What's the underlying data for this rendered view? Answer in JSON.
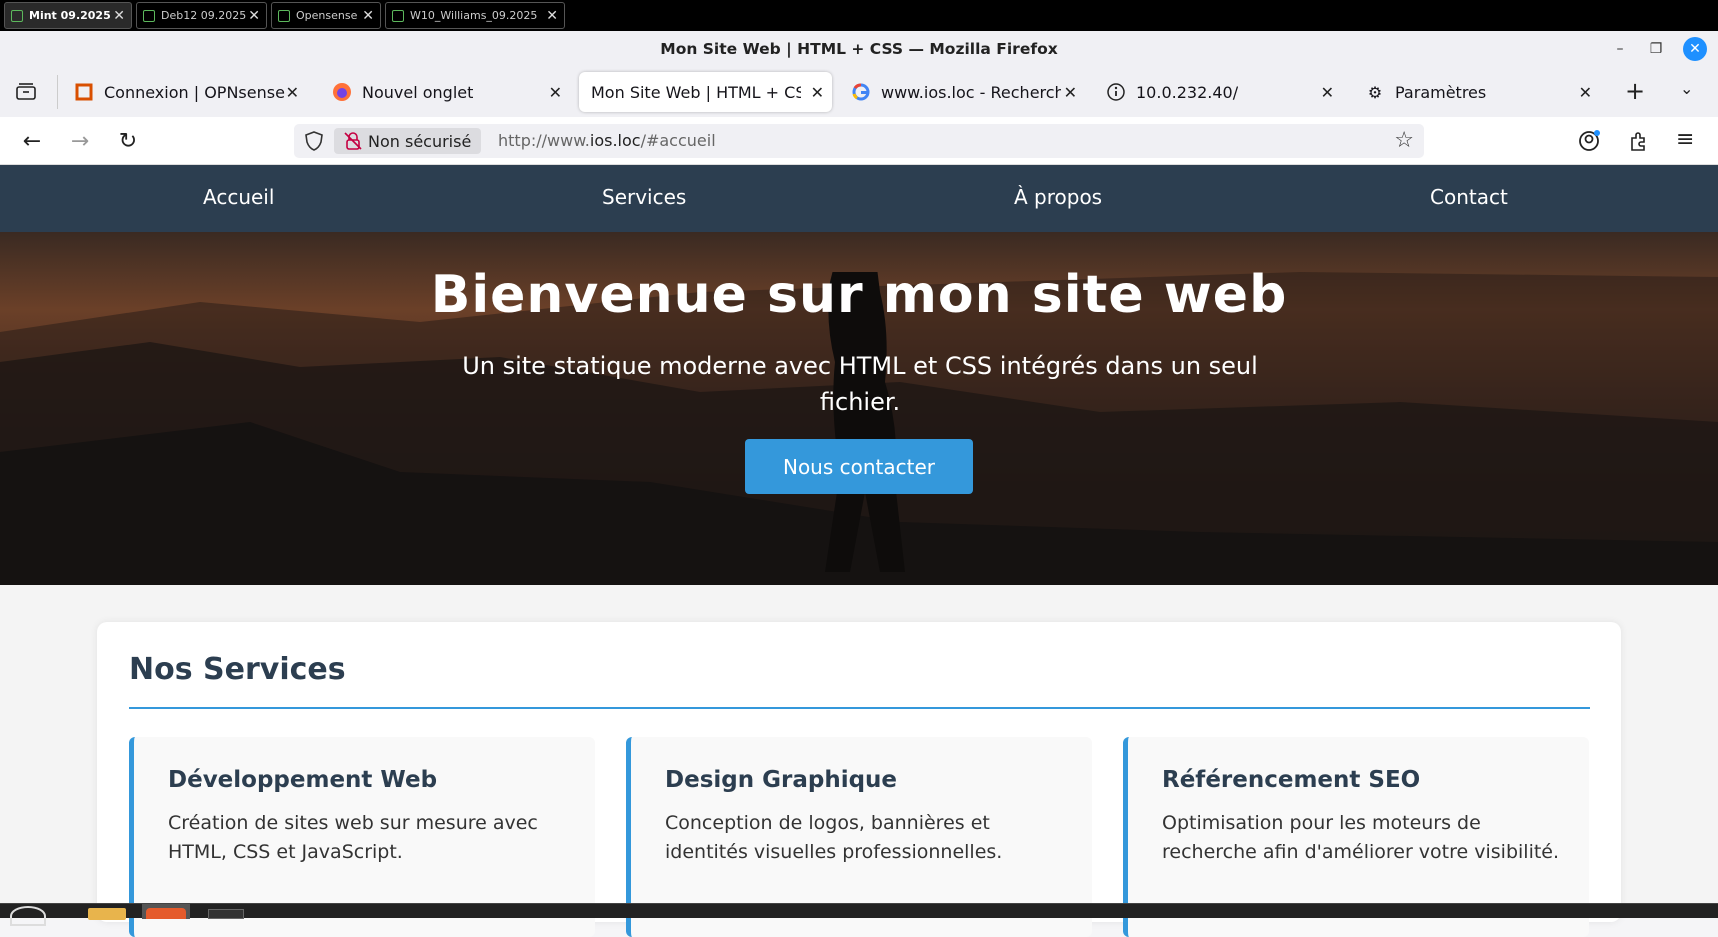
{
  "vm_tabs": [
    {
      "label": "Mint 09.2025",
      "active": true
    },
    {
      "label": "Deb12 09.2025",
      "active": false
    },
    {
      "label": "Opensense",
      "active": false
    },
    {
      "label": "W10_Williams_09.2025",
      "active": false
    }
  ],
  "window": {
    "title": "Mon Site Web | HTML + CSS — Mozilla Firefox"
  },
  "tabs": [
    {
      "label": "Connexion | OPNsense",
      "icon": "opnsense-icon"
    },
    {
      "label": "Nouvel onglet",
      "icon": "firefox-icon"
    },
    {
      "label": "Mon Site Web | HTML + CSS",
      "icon": "none",
      "active": true
    },
    {
      "label": "www.ios.loc - Recherche Google",
      "icon": "google-icon"
    },
    {
      "label": "10.0.232.40/",
      "icon": "info-icon"
    },
    {
      "label": "Paramètres",
      "icon": "gear-icon"
    }
  ],
  "urlbar": {
    "security": "Non sécurisé",
    "url_prefix": "http://www.",
    "url_domain": "ios.loc",
    "url_suffix": "/#accueil"
  },
  "site_nav": [
    "Accueil",
    "Services",
    "À propos",
    "Contact"
  ],
  "hero": {
    "title": "Bienvenue sur mon site web",
    "subtitle": "Un site statique moderne avec HTML et CSS intégrés dans un seul fichier.",
    "button": "Nous contacter"
  },
  "services": {
    "heading": "Nos Services",
    "items": [
      {
        "title": "Développement Web",
        "text": "Création de sites web sur mesure avec HTML, CSS et JavaScript."
      },
      {
        "title": "Design Graphique",
        "text": "Conception de logos, bannières et identités visuelles professionnelles."
      },
      {
        "title": "Référencement SEO",
        "text": "Optimisation pour les moteurs de recherche afin d'améliorer votre visibilité."
      }
    ]
  },
  "colors": {
    "nav_bg": "#2c3e50",
    "accent": "#3498db",
    "heading": "#2c3e50"
  }
}
